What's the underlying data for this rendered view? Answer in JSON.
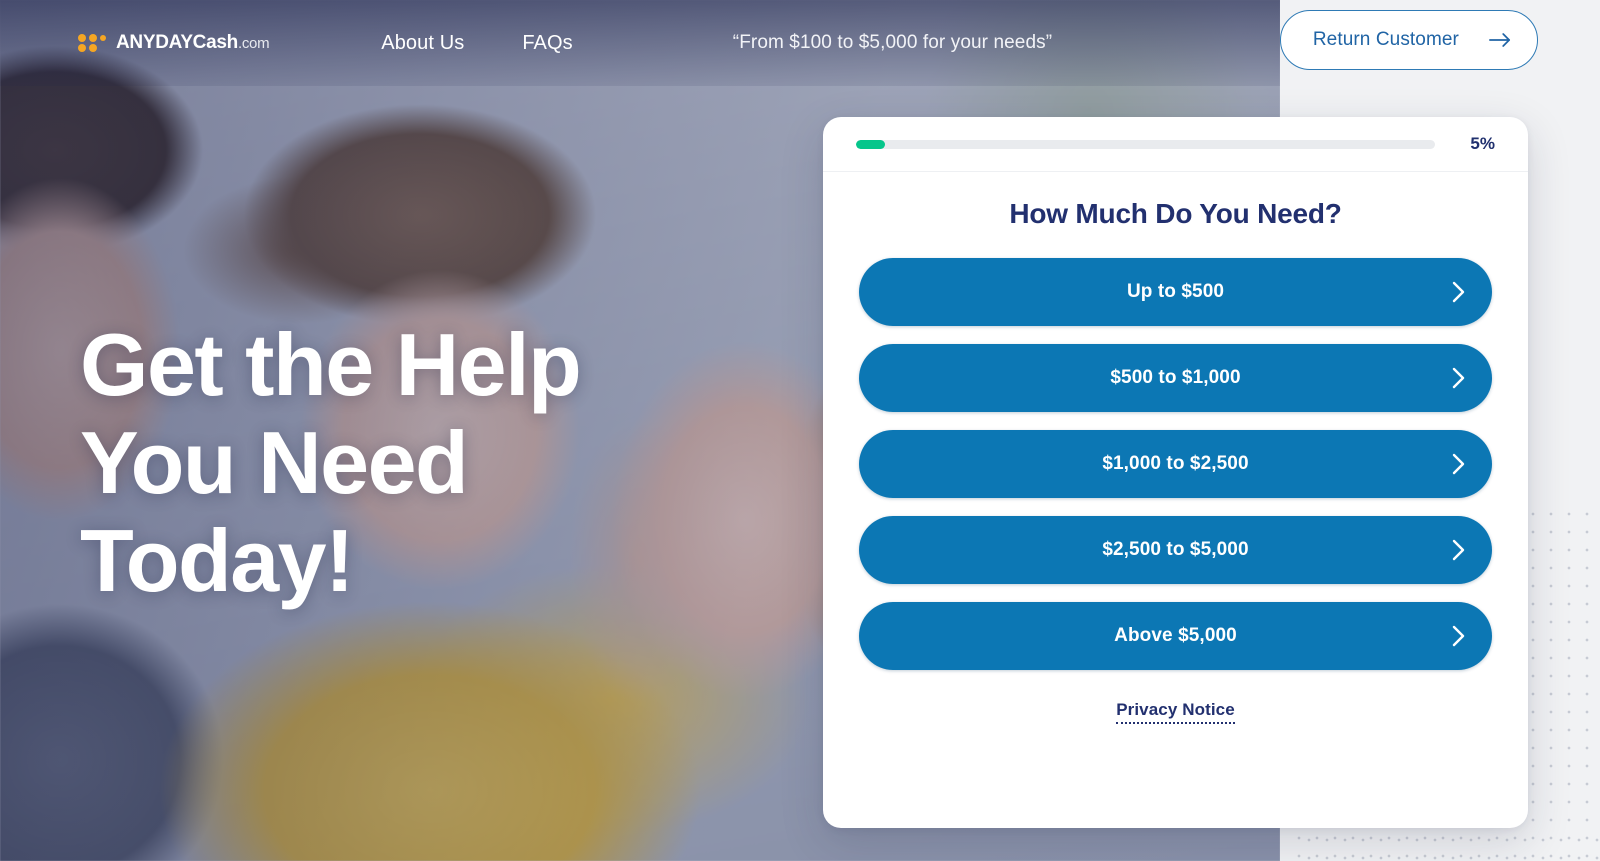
{
  "header": {
    "brand": {
      "name": "ANYDAYCash",
      "tld": ".com",
      "logo_icon": "orange-dots-logo-icon"
    },
    "nav": [
      {
        "label": "About Us"
      },
      {
        "label": "FAQs"
      }
    ],
    "tagline": "“From $100 to $5,000 for your needs”",
    "return_customer": {
      "label": "Return Customer",
      "icon": "arrow-right-icon",
      "text_color": "#2064a5",
      "border_color": "#2e7ab5"
    }
  },
  "hero": {
    "heading_line1": "Get the Help",
    "heading_line2": "You Need",
    "heading_line3": "Today!",
    "heading_full": "Get the Help You Need Today!"
  },
  "quiz": {
    "progress": {
      "percent_label": "5%",
      "percent_value": 5,
      "fill_color": "#06c68b",
      "track_color": "#e9ebee"
    },
    "title": "How Much Do You Need?",
    "options": [
      {
        "label": "Up to $500",
        "icon": "chevron-right-icon"
      },
      {
        "label": "$500 to $1,000",
        "icon": "chevron-right-icon"
      },
      {
        "label": "$1,000 to $2,500",
        "icon": "chevron-right-icon"
      },
      {
        "label": "$2,500 to $5,000",
        "icon": "chevron-right-icon"
      },
      {
        "label": "Above $5,000",
        "icon": "chevron-right-icon"
      }
    ],
    "privacy_link": "Privacy Notice",
    "button_color": "#0c77b4",
    "title_color": "#22306f"
  }
}
